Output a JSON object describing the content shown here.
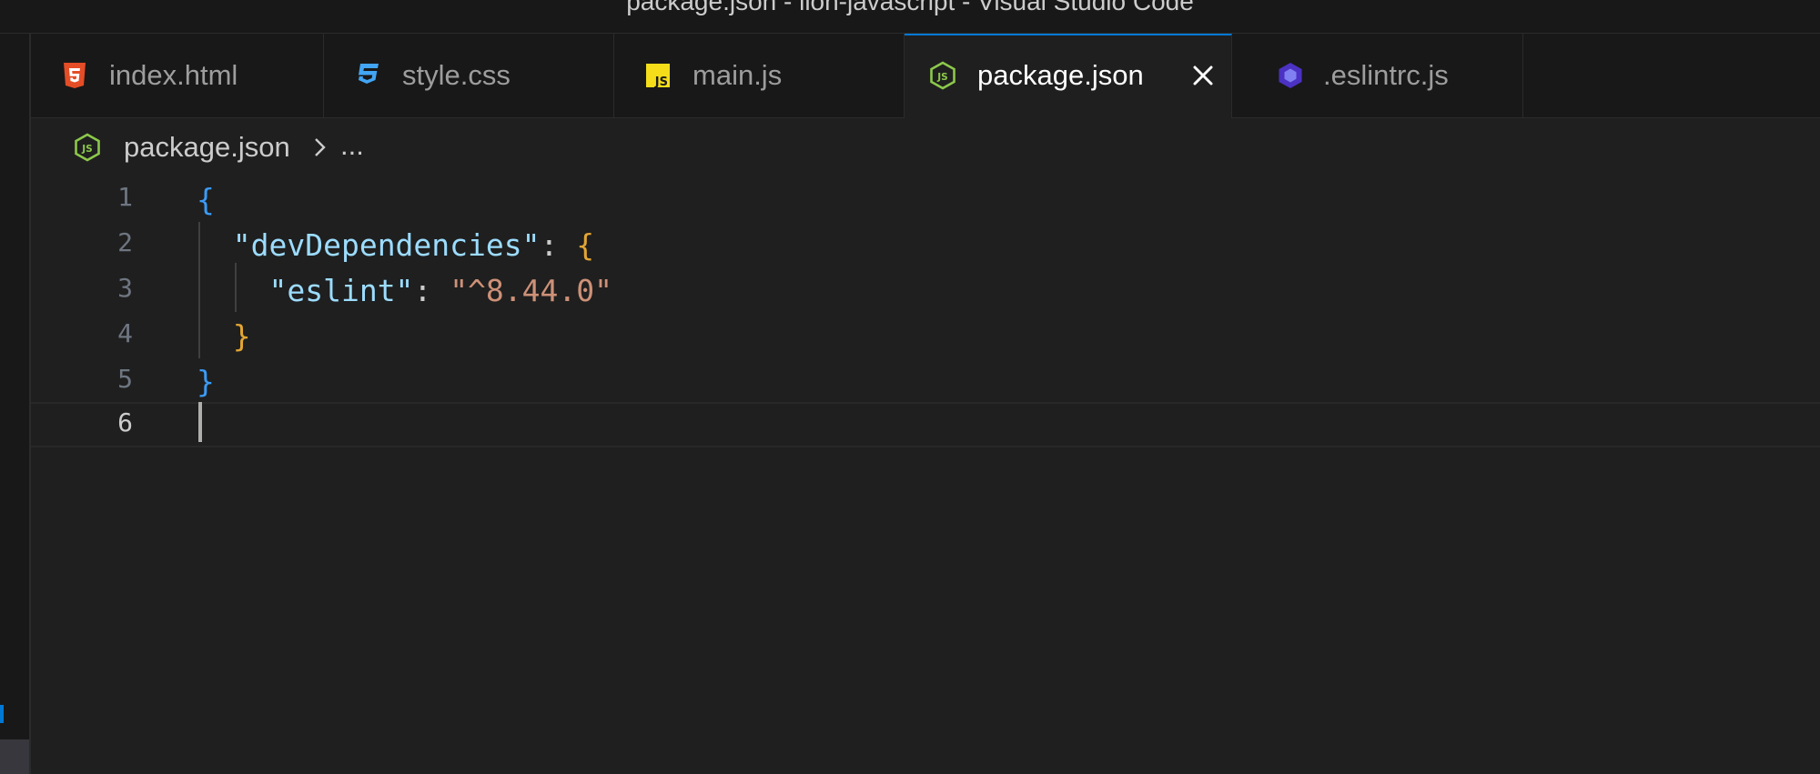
{
  "window": {
    "title": "package.json - lion-javascript - Visual Studio Code"
  },
  "tabs": [
    {
      "label": "index.html",
      "icon": "html5-icon",
      "color": "#e44d26",
      "active": false
    },
    {
      "label": "style.css",
      "icon": "css3-icon",
      "color": "#42a5f5",
      "active": false
    },
    {
      "label": "main.js",
      "icon": "js-icon",
      "color": "#f5de19",
      "active": false
    },
    {
      "label": "package.json",
      "icon": "nodejs-icon",
      "color": "#8cc84b",
      "active": true,
      "close_glyph": "✕"
    },
    {
      "label": ".eslintrc.js",
      "icon": "eslint-icon",
      "color": "#4b32c3",
      "active": false
    }
  ],
  "breadcrumb": {
    "file": "package.json",
    "separator": "chevron-right-icon",
    "more": "..."
  },
  "editor": {
    "language": "json",
    "current_line": 6,
    "lines": [
      {
        "number": "1",
        "tokens": [
          {
            "t": "{",
            "c": "brace-1"
          }
        ]
      },
      {
        "number": "2",
        "tokens": [
          {
            "t": "  "
          },
          {
            "t": "\"devDependencies\"",
            "c": "key"
          },
          {
            "t": ": ",
            "c": "punct"
          },
          {
            "t": "{",
            "c": "brace-2"
          }
        ]
      },
      {
        "number": "3",
        "tokens": [
          {
            "t": "    "
          },
          {
            "t": "\"eslint\"",
            "c": "key"
          },
          {
            "t": ": ",
            "c": "punct"
          },
          {
            "t": "\"^8.44.0\"",
            "c": "string"
          }
        ]
      },
      {
        "number": "4",
        "tokens": [
          {
            "t": "  "
          },
          {
            "t": "}",
            "c": "brace-2"
          }
        ]
      },
      {
        "number": "5",
        "tokens": [
          {
            "t": "}",
            "c": "brace-1"
          }
        ]
      },
      {
        "number": "6",
        "tokens": []
      }
    ]
  },
  "colors": {
    "accent": "#0078d4",
    "key": "#9cdcfe",
    "string": "#ce9178",
    "brace_level_1": "#3b9bf5",
    "brace_level_2": "#e4a633"
  }
}
